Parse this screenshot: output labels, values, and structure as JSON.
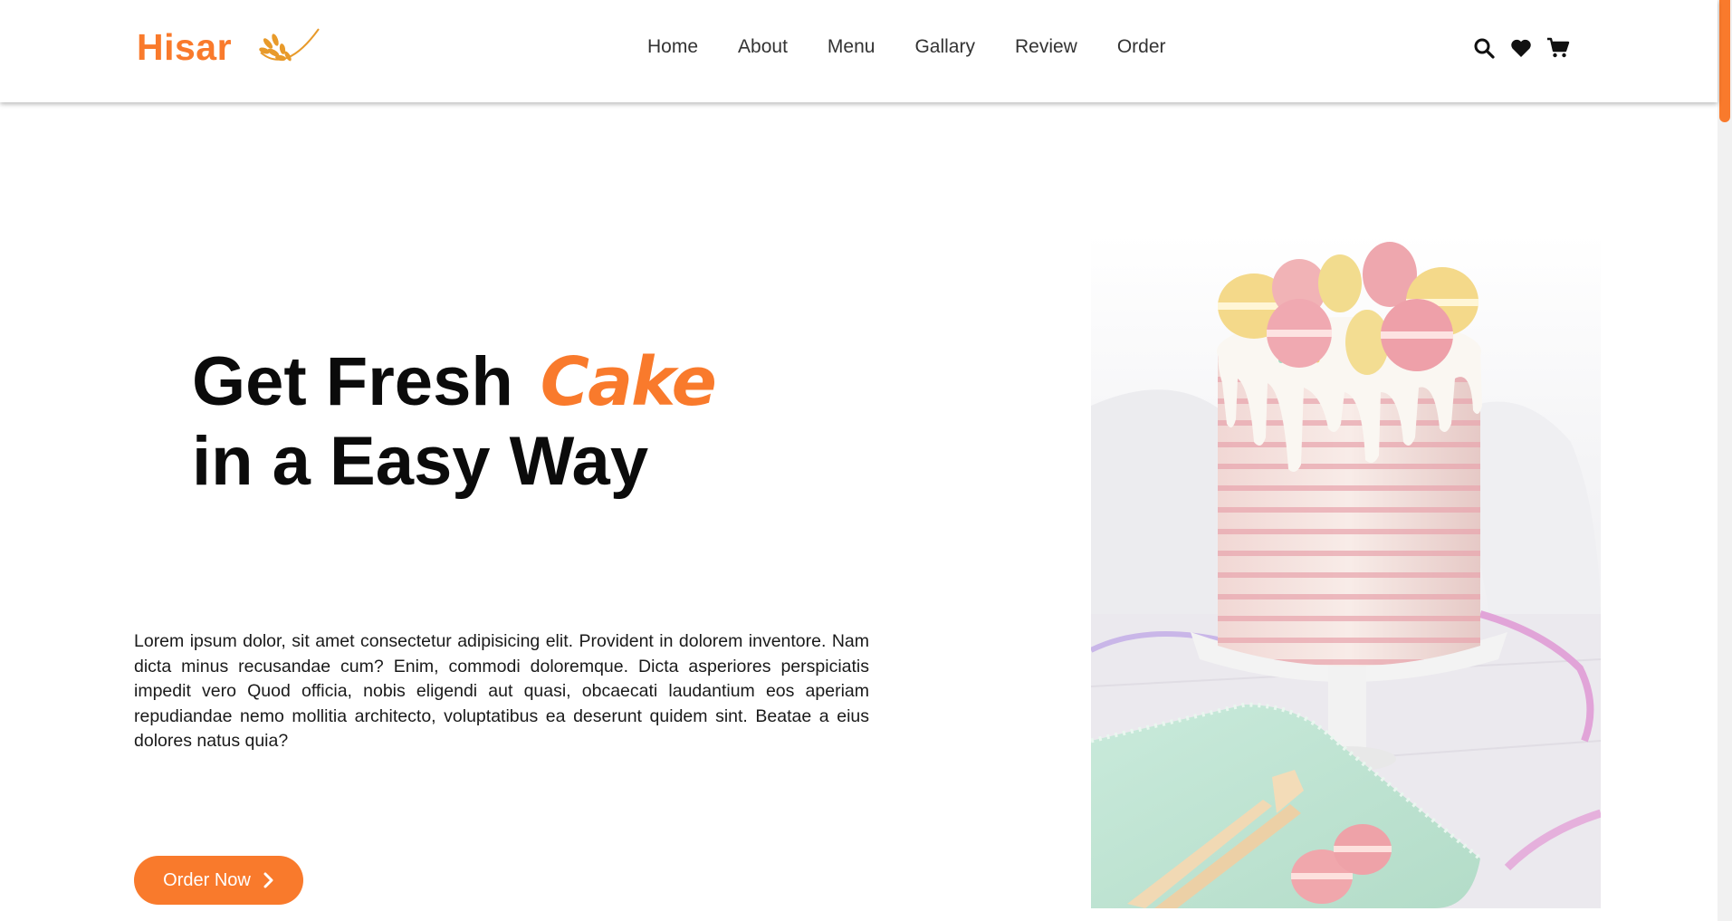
{
  "header": {
    "brand": "Hisar",
    "nav": [
      {
        "label": "Home"
      },
      {
        "label": "About"
      },
      {
        "label": "Menu"
      },
      {
        "label": "Gallary"
      },
      {
        "label": "Review"
      },
      {
        "label": "Order"
      }
    ],
    "icons": [
      "search-icon",
      "heart-icon",
      "cart-icon"
    ]
  },
  "hero": {
    "title_part1": "Get Fresh",
    "title_accent": "Cake",
    "title_line2": "in a Easy Way",
    "description": "Lorem ipsum dolor, sit amet consectetur adipisicing elit. Provident in dolorem inventore. Nam dicta minus recusandae cum? Enim, commodi doloremque. Dicta asperiores perspiciatis impedit vero Quod officia, nobis eligendi aut quasi, obcaecati laudantium eos aperiam repudiandae nemo mollitia architecto, voluptatibus ea deserunt quidem sint. Beatae a eius dolores natus quia?",
    "cta_label": "Order Now"
  },
  "colors": {
    "accent": "#f97a2c",
    "text": "#0b0b0b",
    "background": "#ffffff"
  }
}
